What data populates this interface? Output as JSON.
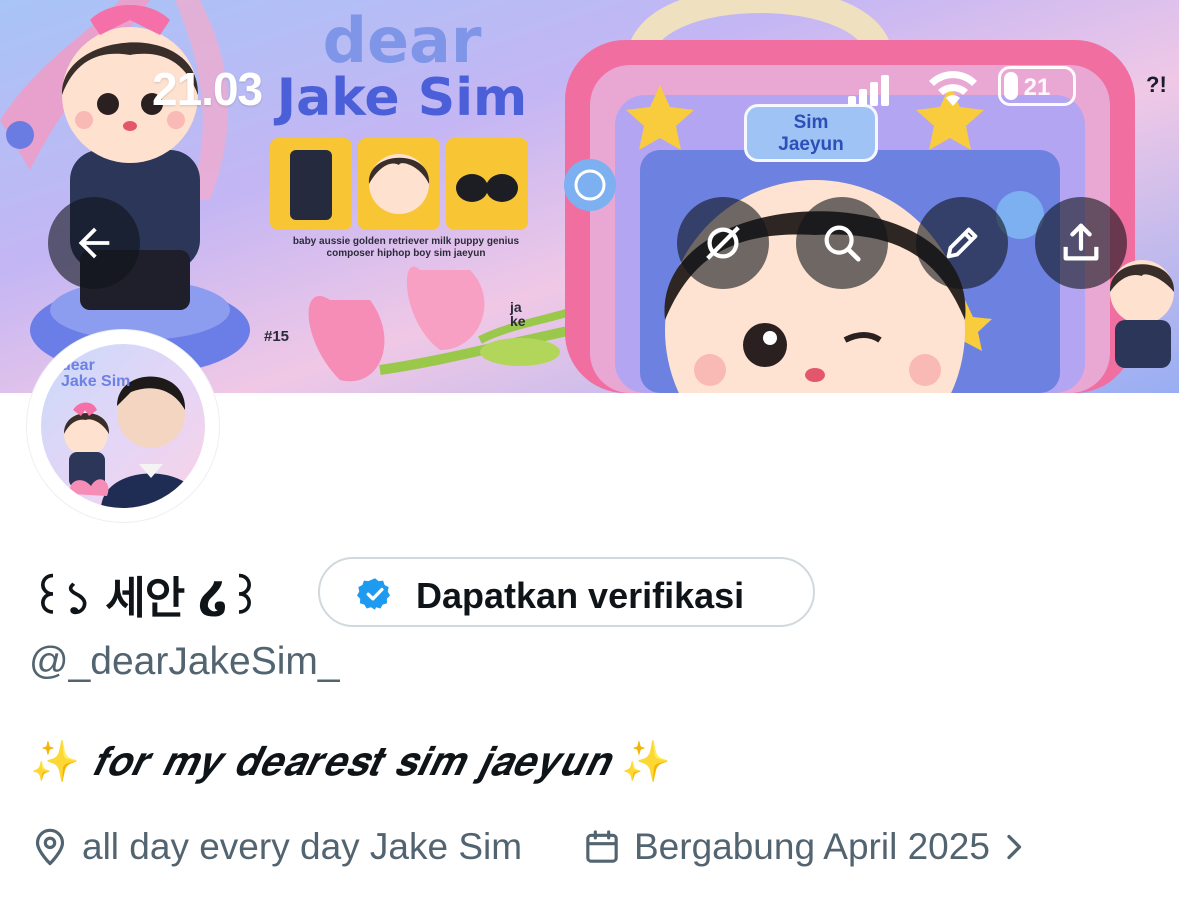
{
  "status_bar": {
    "time": "21.03",
    "battery_level": "21",
    "battery_fraction": 0.21,
    "extra": "?!"
  },
  "header_actions": {
    "back": "arrow-left-icon",
    "grok": "grok-icon",
    "search": "search-icon",
    "edit": "pencil-icon",
    "share": "share-icon"
  },
  "banner": {
    "title_line1": "dear",
    "title_line2": "Jake Sim",
    "caption": "baby aussie golden retriever milk puppy genius composer hiphop boy sim jaeyun",
    "number": "#15",
    "signature": "ja\nke",
    "nameplate": "Sim\nJaeyun"
  },
  "avatar": {
    "text": "dear\nJake Sim"
  },
  "profile": {
    "display_name": "꒰১ 세안 ໒꒱",
    "verify_label": "Dapatkan verifikasi",
    "handle": "@_dearJakeSim_",
    "bio_spark_left": "✨",
    "bio_text": "𝒇𝒐𝒓 𝒎𝒚 𝒅𝒆𝒂𝒓𝒆𝒔𝒕 𝒔𝒊𝒎 𝒋𝒂𝒆𝒚𝒖𝒏",
    "bio_spark_right": "✨",
    "location": "all day every day Jake Sim",
    "joined": "Bergabung April 2025"
  },
  "colors": {
    "accent_blue": "#1d9bf0",
    "secondary_text": "#536471",
    "primary_text": "#0f1419",
    "border": "#cfd9de"
  }
}
